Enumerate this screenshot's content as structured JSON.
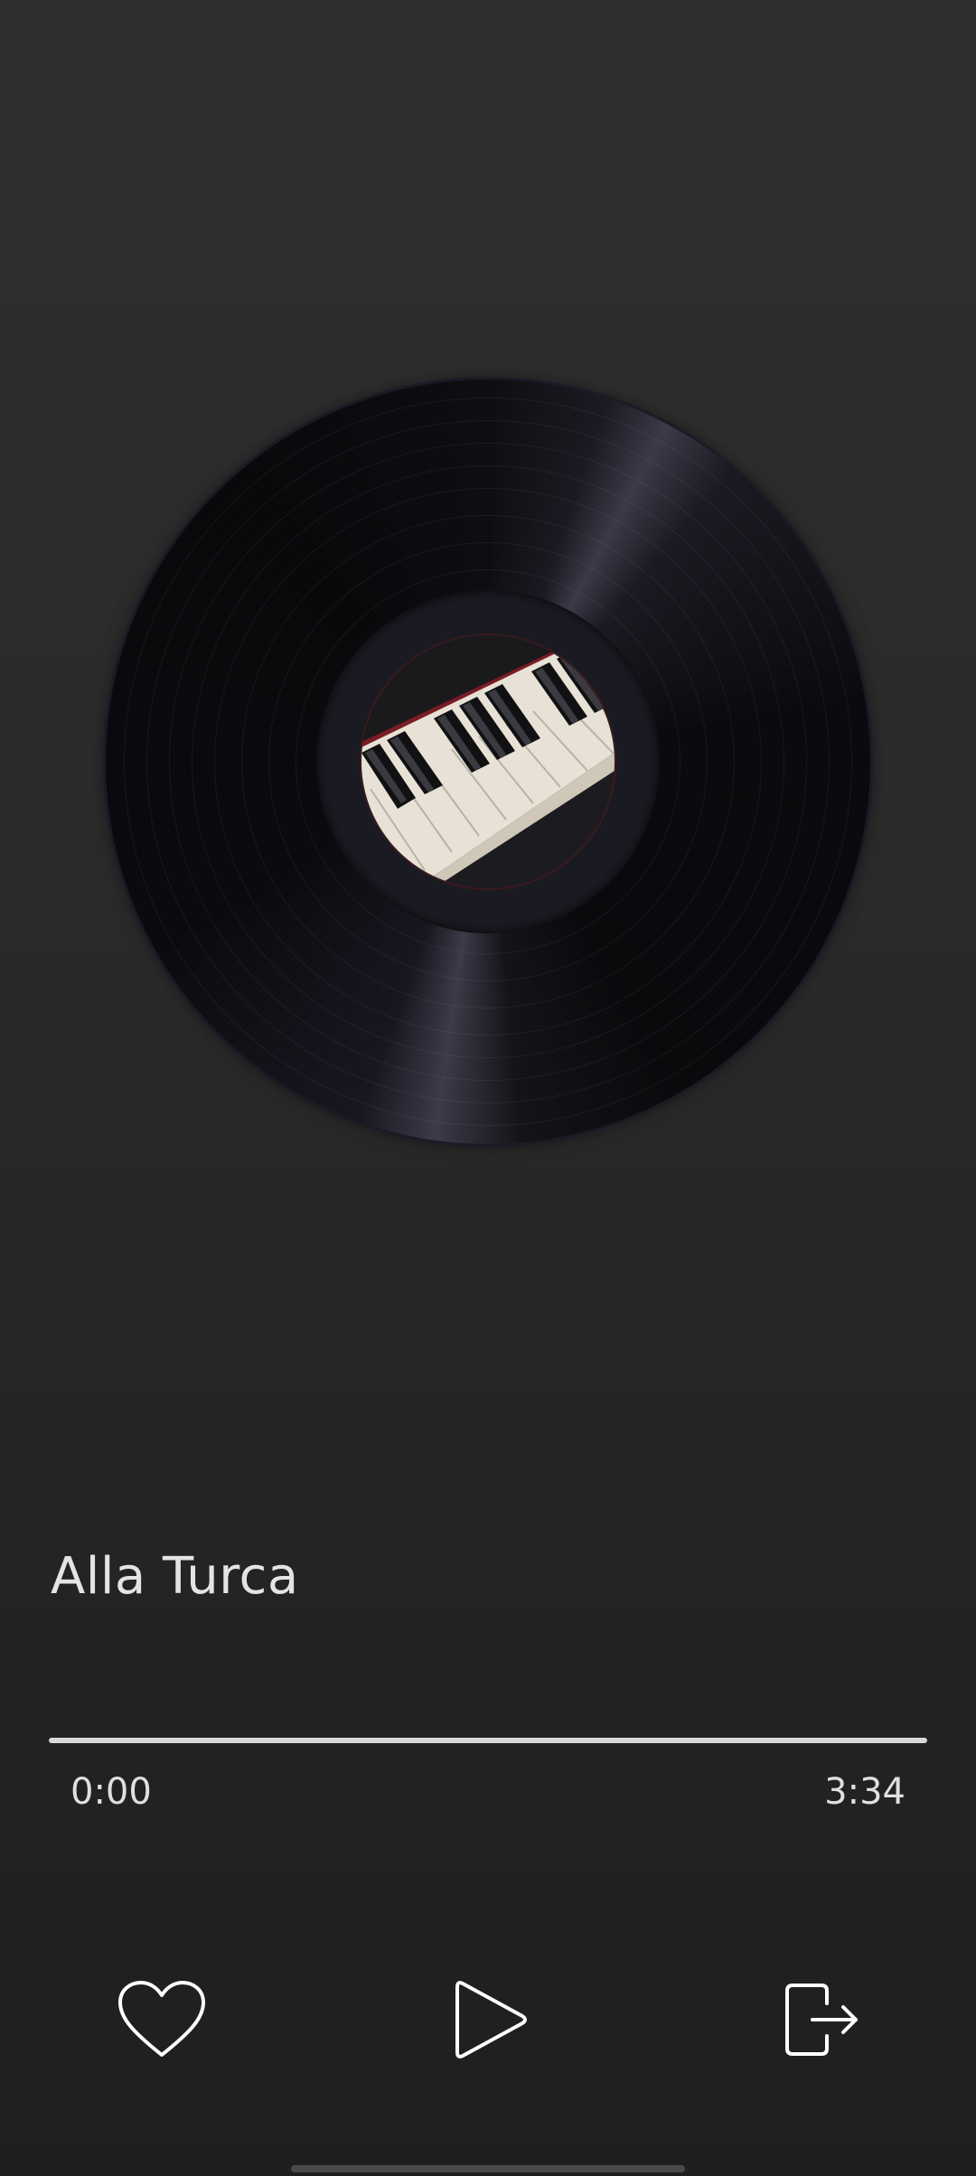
{
  "player": {
    "song_title": "Alla Turca",
    "time_current": "0:00",
    "time_total": "3:34",
    "progress_fraction": 0
  },
  "controls": {
    "like_icon": "heart-outline-icon",
    "play_icon": "play-outline-icon",
    "exit_icon": "exit-door-icon"
  },
  "colors": {
    "background_top": "#2f2f2f",
    "background_bottom": "#1f1f1f",
    "text": "#e4e4e4",
    "progress_track": "#d9d9d9"
  }
}
